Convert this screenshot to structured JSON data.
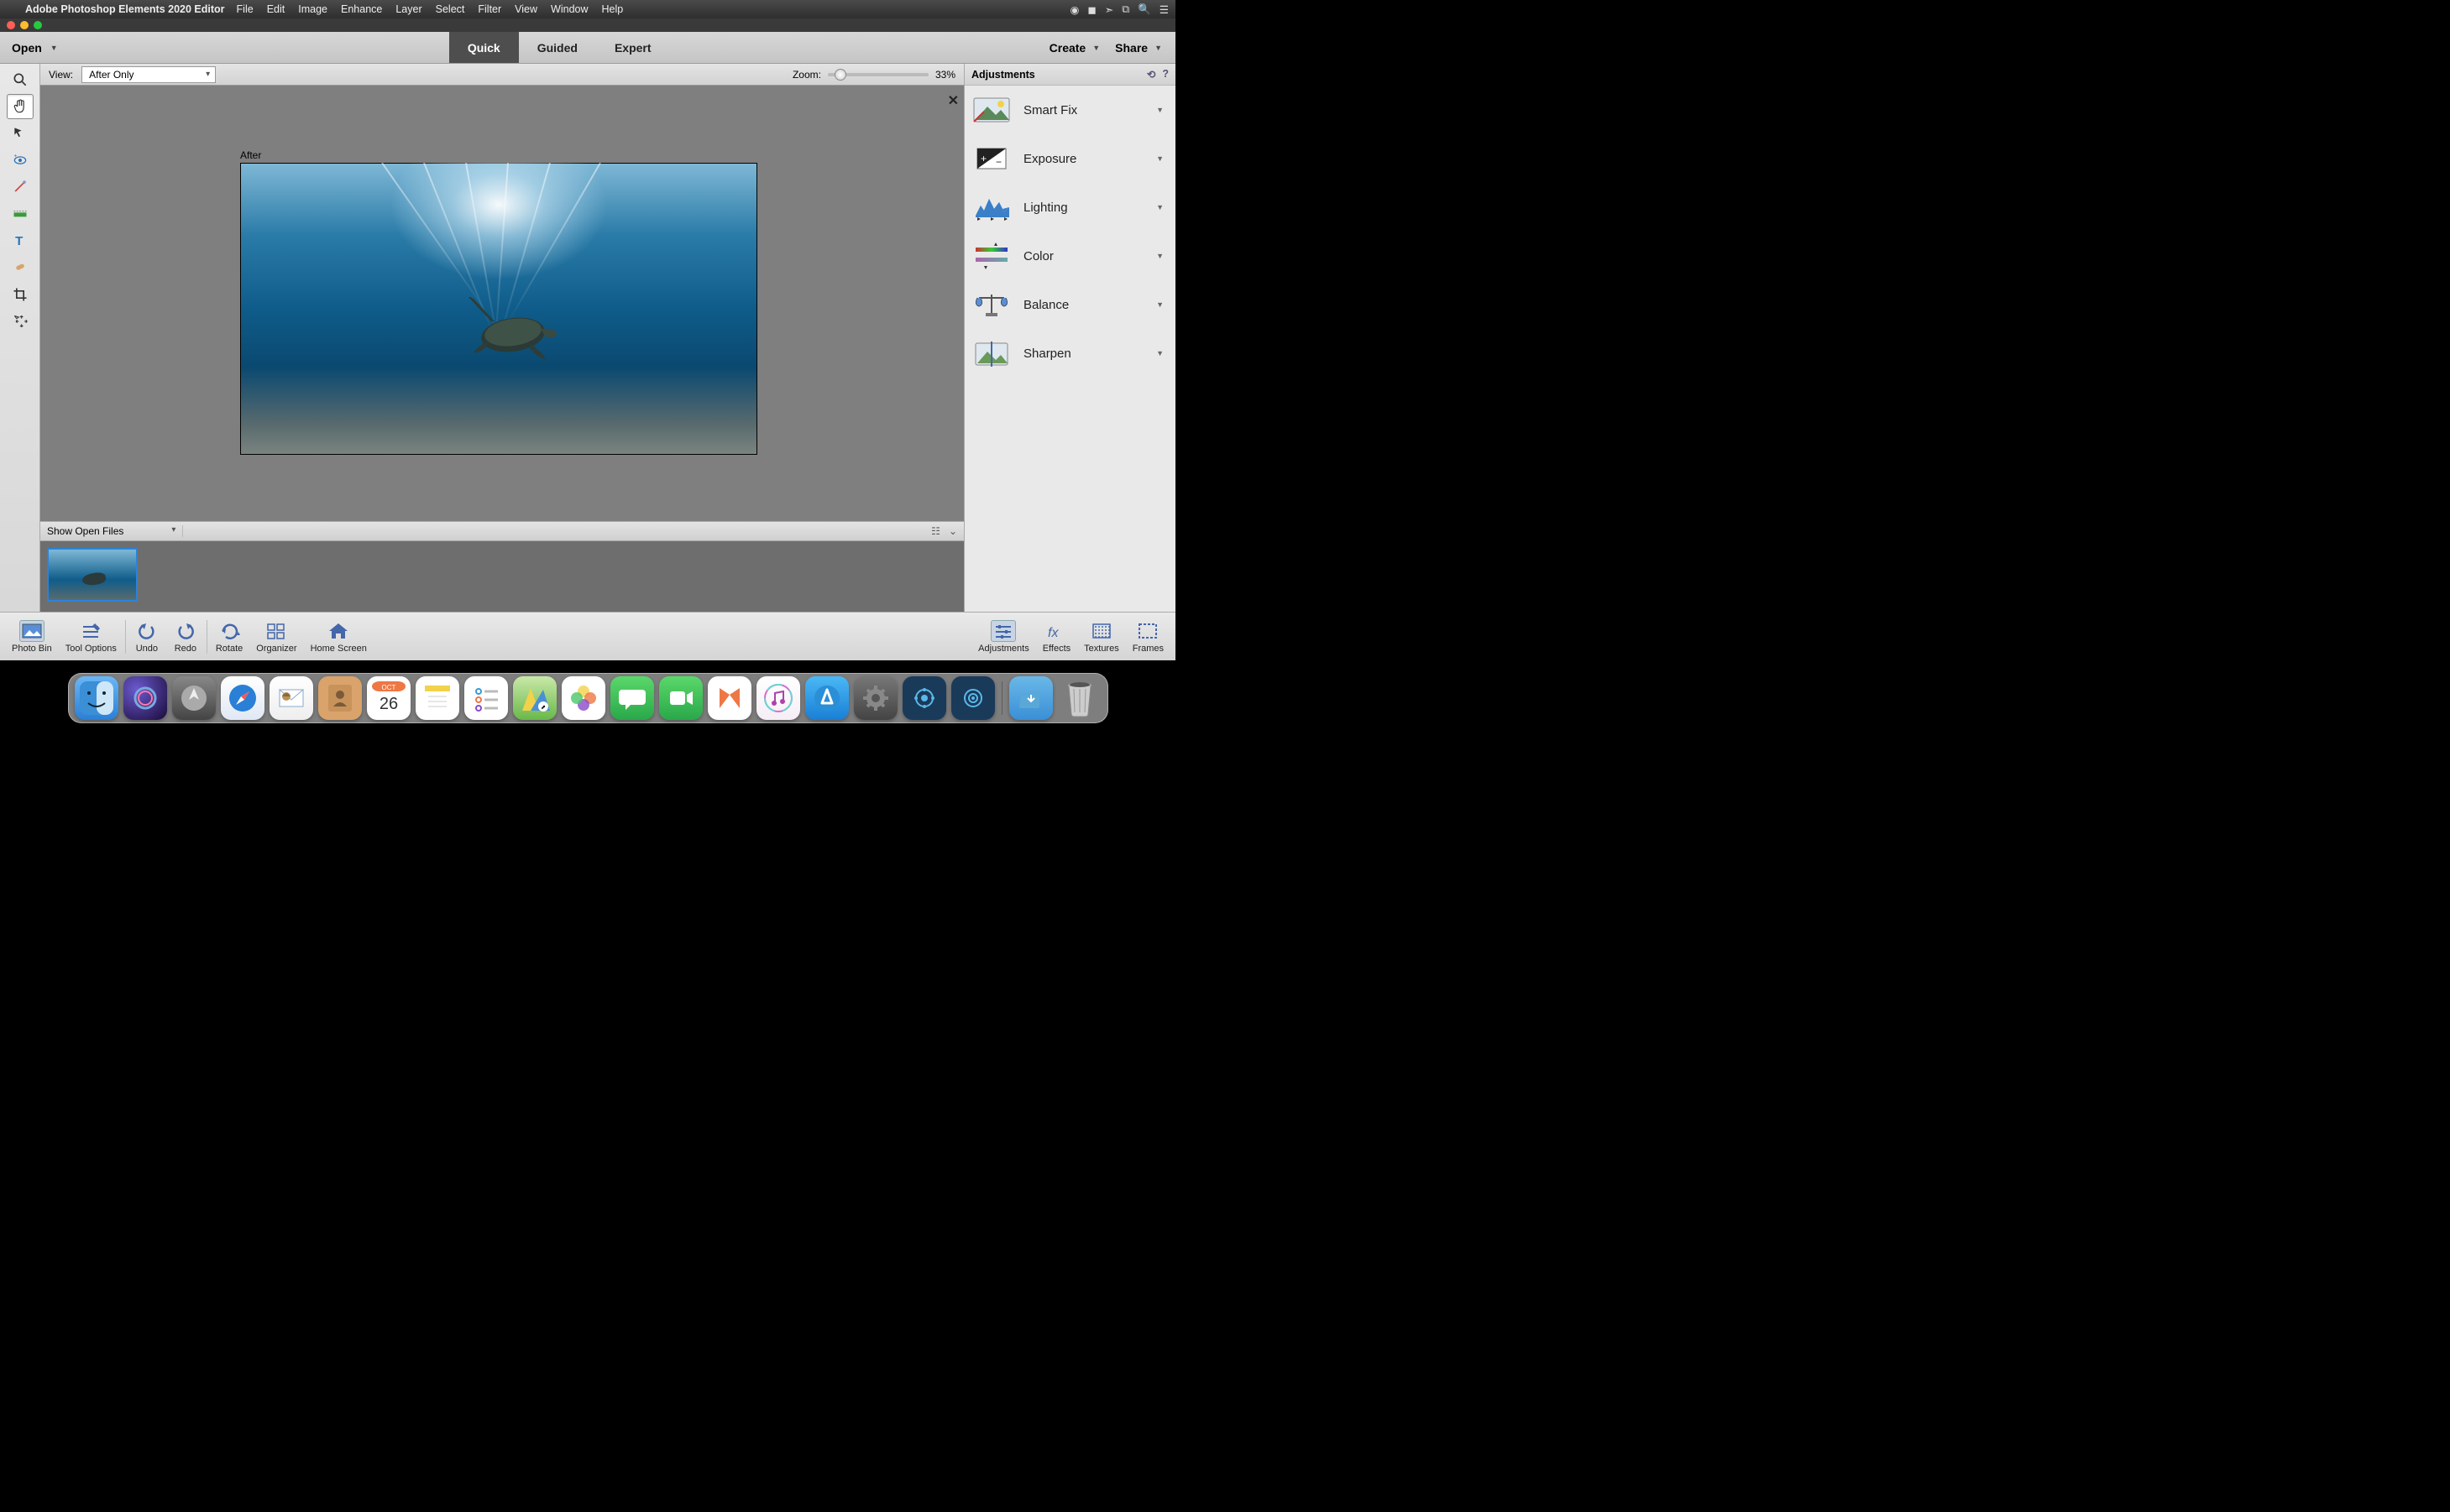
{
  "menubar": {
    "app_name": "Adobe Photoshop Elements 2020 Editor",
    "items": [
      "File",
      "Edit",
      "Image",
      "Enhance",
      "Layer",
      "Select",
      "Filter",
      "View",
      "Window",
      "Help"
    ]
  },
  "toolbar": {
    "open_label": "Open",
    "tabs": {
      "quick": "Quick",
      "guided": "Guided",
      "expert": "Expert",
      "active": "quick"
    },
    "create_label": "Create",
    "share_label": "Share"
  },
  "options_bar": {
    "view_label": "View:",
    "view_value": "After Only",
    "zoom_label": "Zoom:",
    "zoom_value": "33%"
  },
  "canvas": {
    "after_label": "After"
  },
  "photobin": {
    "selector_label": "Show Open Files"
  },
  "adjustments": {
    "title": "Adjustments",
    "items": [
      {
        "label": "Smart Fix"
      },
      {
        "label": "Exposure"
      },
      {
        "label": "Lighting"
      },
      {
        "label": "Color"
      },
      {
        "label": "Balance"
      },
      {
        "label": "Sharpen"
      }
    ]
  },
  "bottombar": {
    "left": [
      {
        "name": "photo-bin",
        "label": "Photo Bin"
      },
      {
        "name": "tool-options",
        "label": "Tool Options"
      },
      {
        "name": "undo",
        "label": "Undo"
      },
      {
        "name": "redo",
        "label": "Redo"
      },
      {
        "name": "rotate",
        "label": "Rotate"
      },
      {
        "name": "organizer",
        "label": "Organizer"
      },
      {
        "name": "home-screen",
        "label": "Home Screen"
      }
    ],
    "right": [
      {
        "name": "adjustments",
        "label": "Adjustments"
      },
      {
        "name": "effects",
        "label": "Effects"
      },
      {
        "name": "textures",
        "label": "Textures"
      },
      {
        "name": "frames",
        "label": "Frames"
      }
    ]
  },
  "dock": {
    "date_month": "OCT",
    "date_day": "26"
  }
}
